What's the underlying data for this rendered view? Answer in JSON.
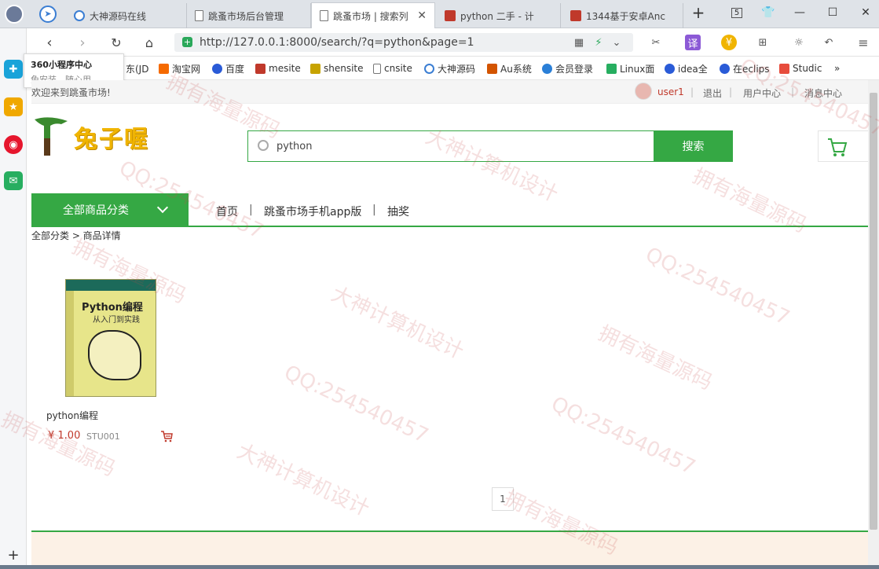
{
  "browser": {
    "tabs": [
      {
        "label": "大神源码在线"
      },
      {
        "label": "跳蚤市场后台管理"
      },
      {
        "label": "跳蚤市场 | 搜索列"
      },
      {
        "label": "python 二手 - 计"
      },
      {
        "label": "1344基于安卓Anc"
      }
    ],
    "tab_count_badge": "5",
    "address": "http://127.0.0.1:8000/search/?q=python&page=1"
  },
  "bookmarks": [
    "东(JD",
    "淘宝网",
    "百度",
    "mesite",
    "shensite",
    "cnsite",
    "大神源码",
    "Au系统",
    "会员登录",
    "Linux面",
    "idea全",
    "在eclips",
    "Studic",
    "»"
  ],
  "sidebar": {
    "tooltip_title": "360小程序中心",
    "tooltip_subtitle": "免安装，随心用"
  },
  "topbar": {
    "welcome": "欢迎来到跳蚤市场!",
    "username": "user1",
    "links": [
      "退出",
      "用户中心",
      "消息中心"
    ]
  },
  "header": {
    "logo_text": "兔子喔",
    "search_value": "python",
    "search_button": "搜索"
  },
  "nav": {
    "category_label": "全部商品分类",
    "links": [
      "首页",
      "跳蚤市场手机app版",
      "抽奖"
    ]
  },
  "breadcrumb": "全部分类 > 商品详情",
  "products": [
    {
      "name": "python编程",
      "price": "¥ 1.00",
      "code": "STU001",
      "cover_title": "Python编程",
      "cover_subtitle": "从入门到实践"
    }
  ],
  "pagination": {
    "current": "1"
  },
  "watermark_texts": [
    "拥有海量源码",
    "QQ:254540457",
    "大神计算机设计"
  ],
  "colors": {
    "accent": "#35a844",
    "price": "#c0392b",
    "footer_bg": "#fcf1e6"
  }
}
